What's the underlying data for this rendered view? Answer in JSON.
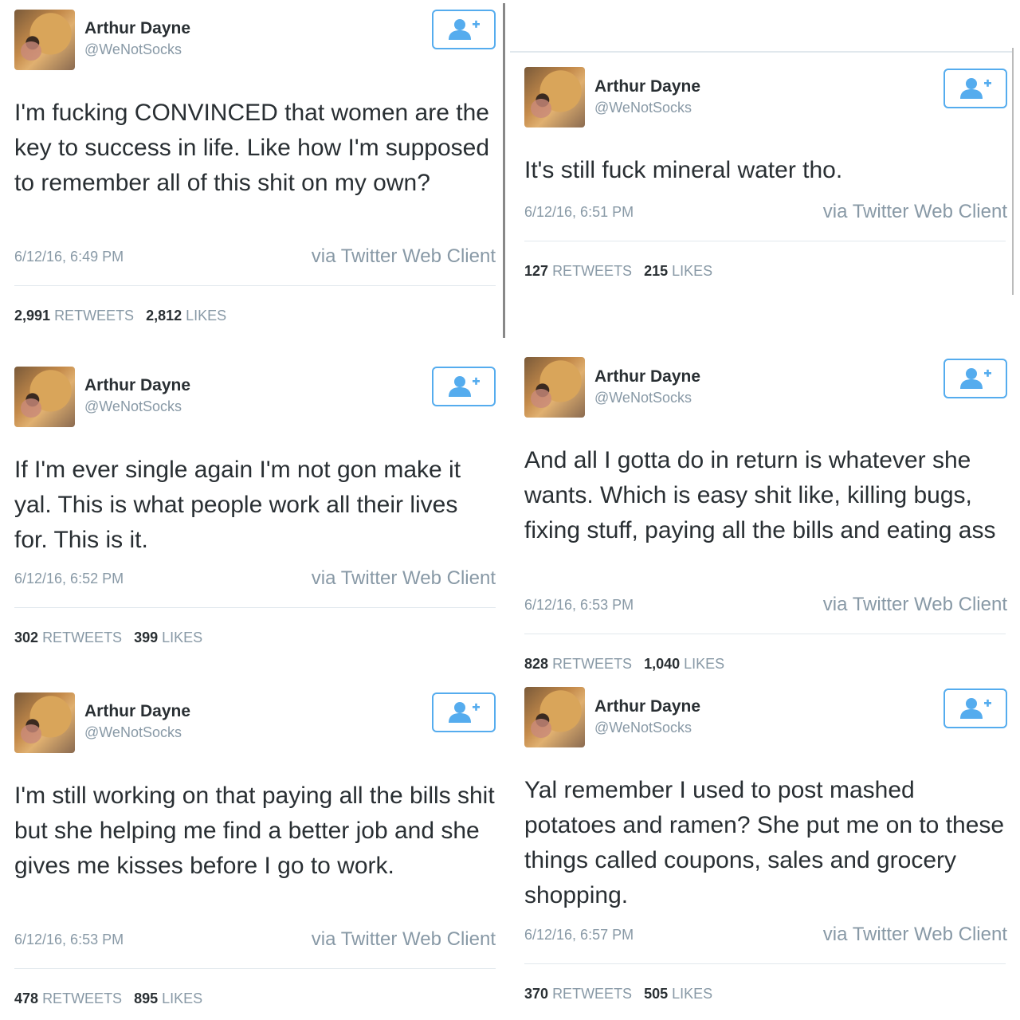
{
  "tweets": [
    {
      "name": "Arthur Dayne",
      "handle": "@WeNotSocks",
      "text": "I'm fucking CONVINCED that women are the key to success in life. Like how I'm supposed to remember all of this shit on my own?",
      "time": "6/12/16, 6:49 PM",
      "via": "via Twitter Web Client",
      "retweets": "2,991",
      "retweets_label": "RETWEETS",
      "likes": "2,812",
      "likes_label": "LIKES"
    },
    {
      "name": "Arthur Dayne",
      "handle": "@WeNotSocks",
      "text": "It's still fuck mineral water tho.",
      "time": "6/12/16, 6:51 PM",
      "via": "via Twitter Web Client",
      "retweets": "127",
      "retweets_label": "RETWEETS",
      "likes": "215",
      "likes_label": "LIKES"
    },
    {
      "name": "Arthur Dayne",
      "handle": "@WeNotSocks",
      "text": "If I'm ever single again I'm not gon make it yal. This is what people work all their lives for. This is it.",
      "time": "6/12/16, 6:52 PM",
      "via": "via Twitter Web Client",
      "retweets": "302",
      "retweets_label": "RETWEETS",
      "likes": "399",
      "likes_label": "LIKES"
    },
    {
      "name": "Arthur Dayne",
      "handle": "@WeNotSocks",
      "text": "And all I gotta do in return is whatever she wants. Which is easy shit like, killing bugs, fixing stuff, paying all the bills and eating ass",
      "time": "6/12/16, 6:53 PM",
      "via": "via Twitter Web Client",
      "retweets": "828",
      "retweets_label": "RETWEETS",
      "likes": "1,040",
      "likes_label": "LIKES"
    },
    {
      "name": "Arthur Dayne",
      "handle": "@WeNotSocks",
      "text": "I'm still working on that paying all the bills shit but she helping me find a better job and she gives me kisses before I go to work.",
      "time": "6/12/16, 6:53 PM",
      "via": "via Twitter Web Client",
      "retweets": "478",
      "retweets_label": "RETWEETS",
      "likes": "895",
      "likes_label": "LIKES"
    },
    {
      "name": "Arthur Dayne",
      "handle": "@WeNotSocks",
      "text": "Yal remember I used to post mashed potatoes and ramen? She put me on to these things called coupons, sales and grocery shopping.",
      "time": "6/12/16, 6:57 PM",
      "via": "via Twitter Web Client",
      "retweets": "370",
      "retweets_label": "RETWEETS",
      "likes": "505",
      "likes_label": "LIKES"
    }
  ],
  "icons": {
    "follow": "add-user-icon"
  },
  "colors": {
    "accent": "#55acee",
    "muted": "#8899a6",
    "text": "#292f33"
  }
}
